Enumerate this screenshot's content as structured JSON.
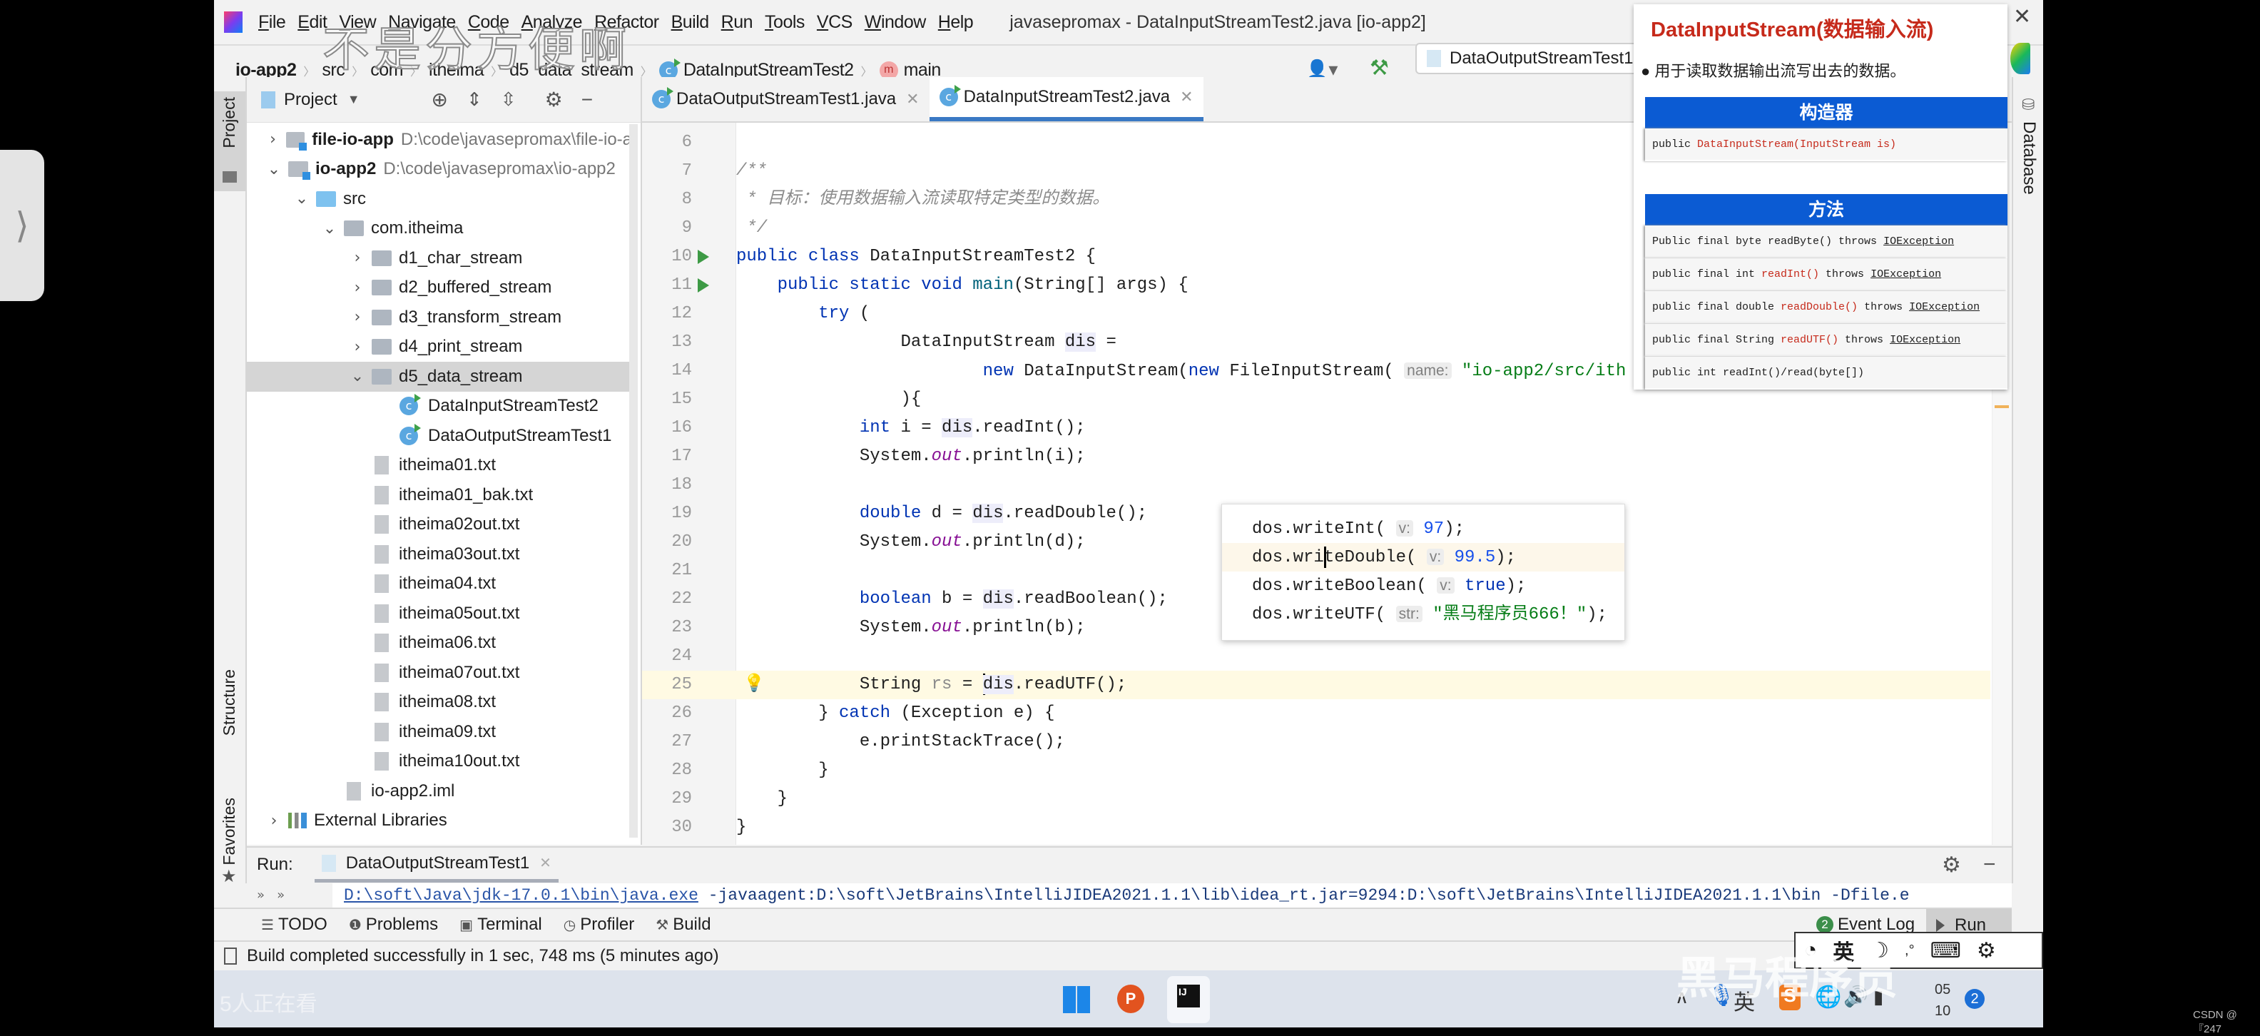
{
  "window": {
    "title": "javasepromax - DataInputStreamTest2.java [io-app2]",
    "watermark": "不是分方便啊"
  },
  "menu": [
    "File",
    "Edit",
    "View",
    "Navigate",
    "Code",
    "Analyze",
    "Refactor",
    "Build",
    "Run",
    "Tools",
    "VCS",
    "Window",
    "Help"
  ],
  "breadcrumb": [
    "io-app2",
    "src",
    "com",
    "itheima",
    "d5_data_stream",
    "DataInputStreamTest2",
    "main"
  ],
  "toolbar": {
    "run_config": "DataOutputStreamTest1"
  },
  "left_strip": {
    "project": "Project",
    "structure": "Structure",
    "favorites": "Favorites"
  },
  "right_strip": {
    "database": "Database"
  },
  "project_panel": {
    "title": "Project",
    "tree": [
      {
        "label": "file-io-app",
        "path": "D:\\code\\javasepromax\\file-io-a",
        "depth": 0,
        "expanded": false,
        "icon": "module",
        "bold": true
      },
      {
        "label": "io-app2",
        "path": "D:\\code\\javasepromax\\io-app2",
        "depth": 0,
        "expanded": true,
        "icon": "module",
        "bold": true
      },
      {
        "label": "src",
        "depth": 1,
        "expanded": true,
        "icon": "source-folder"
      },
      {
        "label": "com.itheima",
        "depth": 2,
        "expanded": true,
        "icon": "package"
      },
      {
        "label": "d1_char_stream",
        "depth": 3,
        "expanded": false,
        "icon": "package"
      },
      {
        "label": "d2_buffered_stream",
        "depth": 3,
        "expanded": false,
        "icon": "package"
      },
      {
        "label": "d3_transform_stream",
        "depth": 3,
        "expanded": false,
        "icon": "package"
      },
      {
        "label": "d4_print_stream",
        "depth": 3,
        "expanded": false,
        "icon": "package"
      },
      {
        "label": "d5_data_stream",
        "depth": 3,
        "expanded": true,
        "icon": "package",
        "selected": true
      },
      {
        "label": "DataInputStreamTest2",
        "depth": 4,
        "icon": "class"
      },
      {
        "label": "DataOutputStreamTest1",
        "depth": 4,
        "icon": "class"
      },
      {
        "label": "itheima01.txt",
        "depth": 3,
        "icon": "text-file"
      },
      {
        "label": "itheima01_bak.txt",
        "depth": 3,
        "icon": "text-file"
      },
      {
        "label": "itheima02out.txt",
        "depth": 3,
        "icon": "text-file"
      },
      {
        "label": "itheima03out.txt",
        "depth": 3,
        "icon": "text-file"
      },
      {
        "label": "itheima04.txt",
        "depth": 3,
        "icon": "text-file"
      },
      {
        "label": "itheima05out.txt",
        "depth": 3,
        "icon": "text-file"
      },
      {
        "label": "itheima06.txt",
        "depth": 3,
        "icon": "text-file"
      },
      {
        "label": "itheima07out.txt",
        "depth": 3,
        "icon": "text-file"
      },
      {
        "label": "itheima08.txt",
        "depth": 3,
        "icon": "text-file"
      },
      {
        "label": "itheima09.txt",
        "depth": 3,
        "icon": "text-file"
      },
      {
        "label": "itheima10out.txt",
        "depth": 3,
        "icon": "text-file"
      },
      {
        "label": "io-app2.iml",
        "depth": 2,
        "icon": "iml-file"
      },
      {
        "label": "External Libraries",
        "depth": 0,
        "expanded": false,
        "icon": "library"
      }
    ]
  },
  "editor": {
    "tabs": [
      {
        "label": "DataOutputStreamTest1.java",
        "active": false
      },
      {
        "label": "DataInputStreamTest2.java",
        "active": true
      }
    ],
    "current_line": 25,
    "lines": [
      {
        "n": 6,
        "t": []
      },
      {
        "n": 7,
        "t": [
          [
            "c",
            "/**"
          ]
        ]
      },
      {
        "n": 8,
        "t": [
          [
            "c",
            " * 目标：使用数据输入流读取特定类型的数据。"
          ]
        ]
      },
      {
        "n": 9,
        "t": [
          [
            "c",
            " */"
          ]
        ]
      },
      {
        "n": 10,
        "run": true,
        "t": [
          [
            "k",
            "public class "
          ],
          [
            "p",
            "DataInputStreamTest2 {"
          ]
        ]
      },
      {
        "n": 11,
        "run": true,
        "t": [
          [
            "p",
            "    "
          ],
          [
            "k",
            "public static void "
          ],
          [
            "m",
            "main"
          ],
          [
            "p",
            "(String[] args) {"
          ]
        ]
      },
      {
        "n": 12,
        "t": [
          [
            "p",
            "        "
          ],
          [
            "k",
            "try"
          ],
          [
            "p",
            " ("
          ]
        ]
      },
      {
        "n": 13,
        "t": [
          [
            "p",
            "                DataInputStream "
          ],
          [
            "v",
            "dis"
          ],
          [
            "p",
            " ="
          ]
        ]
      },
      {
        "n": 14,
        "t": [
          [
            "p",
            "                        "
          ],
          [
            "k",
            "new "
          ],
          [
            "p",
            "DataInputStream("
          ],
          [
            "k",
            "new "
          ],
          [
            "p",
            "FileInputStream( "
          ],
          [
            "h",
            "name:"
          ],
          [
            "s",
            " \"io-app2/src/ith"
          ]
        ]
      },
      {
        "n": 15,
        "t": [
          [
            "p",
            "                ){"
          ]
        ]
      },
      {
        "n": 16,
        "t": [
          [
            "p",
            "            "
          ],
          [
            "k",
            "int "
          ],
          [
            "p",
            "i = "
          ],
          [
            "v",
            "dis"
          ],
          [
            "p",
            ".readInt();"
          ]
        ]
      },
      {
        "n": 17,
        "t": [
          [
            "p",
            "            System."
          ],
          [
            "f",
            "out"
          ],
          [
            "p",
            ".println(i);"
          ]
        ]
      },
      {
        "n": 18,
        "t": []
      },
      {
        "n": 19,
        "t": [
          [
            "p",
            "            "
          ],
          [
            "k",
            "double "
          ],
          [
            "p",
            "d = "
          ],
          [
            "v",
            "dis"
          ],
          [
            "p",
            ".readDouble();"
          ]
        ]
      },
      {
        "n": 20,
        "t": [
          [
            "p",
            "            System."
          ],
          [
            "f",
            "out"
          ],
          [
            "p",
            ".println(d);"
          ]
        ]
      },
      {
        "n": 21,
        "t": []
      },
      {
        "n": 22,
        "t": [
          [
            "p",
            "            "
          ],
          [
            "k",
            "boolean "
          ],
          [
            "p",
            "b = "
          ],
          [
            "v",
            "dis"
          ],
          [
            "p",
            ".readBoolean();"
          ]
        ]
      },
      {
        "n": 23,
        "t": [
          [
            "p",
            "            System."
          ],
          [
            "f",
            "out"
          ],
          [
            "p",
            ".println(b);"
          ]
        ]
      },
      {
        "n": 24,
        "t": []
      },
      {
        "n": 25,
        "bulb": true,
        "t": [
          [
            "p",
            "            String "
          ],
          [
            "g",
            "rs"
          ],
          [
            "p",
            " = "
          ],
          [
            "caret",
            ""
          ],
          [
            "v",
            "dis"
          ],
          [
            "p",
            ".readUTF();"
          ]
        ]
      },
      {
        "n": 26,
        "t": [
          [
            "p",
            "        } "
          ],
          [
            "k",
            "catch "
          ],
          [
            "p",
            "(Exception e) {"
          ]
        ]
      },
      {
        "n": 27,
        "t": [
          [
            "p",
            "            e.printStackTrace();"
          ]
        ]
      },
      {
        "n": 28,
        "t": [
          [
            "p",
            "        }"
          ]
        ]
      },
      {
        "n": 29,
        "t": [
          [
            "p",
            "    }"
          ]
        ]
      },
      {
        "n": 30,
        "t": [
          [
            "p",
            "}"
          ]
        ]
      }
    ]
  },
  "snippet_popup": {
    "lines": [
      {
        "t": [
          [
            "p",
            "dos.writeInt( "
          ],
          [
            "h",
            "v:"
          ],
          [
            "n",
            " 97"
          ],
          [
            "p",
            ");"
          ]
        ]
      },
      {
        "hl": true,
        "t": [
          [
            "p",
            "dos.wri"
          ],
          [
            "caret",
            ""
          ],
          [
            "p",
            "teDouble( "
          ],
          [
            "h",
            "v:"
          ],
          [
            "n",
            " 99.5"
          ],
          [
            "p",
            ");"
          ]
        ]
      },
      {
        "t": [
          [
            "p",
            "dos.writeBoolean( "
          ],
          [
            "h",
            "v:"
          ],
          [
            "k",
            " true"
          ],
          [
            "p",
            ");"
          ]
        ]
      },
      {
        "t": [
          [
            "p",
            "dos.writeUTF( "
          ],
          [
            "h",
            "str:"
          ],
          [
            "s",
            " \"黑马程序员666！\""
          ],
          [
            "p",
            ");"
          ]
        ]
      }
    ]
  },
  "doc_popup": {
    "title": "DataInputStream(数据输入流)",
    "bullet": "用于读取数据输出流写出去的数据。",
    "constructor_header": "构造器",
    "constructor": {
      "pre": "public ",
      "sig": "DataInputStream(InputStream is)"
    },
    "methods_header": "方法",
    "methods": [
      {
        "pre": "Public final byte readByte() throws ",
        "hl": "",
        "post": "",
        "exc": "IOException"
      },
      {
        "pre": "public final int ",
        "hl": "readInt()",
        "post": " throws ",
        "exc": "IOException"
      },
      {
        "pre": "public final double ",
        "hl": "readDouble()",
        "post": " throws ",
        "exc": "IOException"
      },
      {
        "pre": "public final String ",
        "hl": "readUTF()",
        "post": " throws ",
        "exc": "IOException"
      },
      {
        "pre": "public int readInt()/read(byte[])",
        "hl": "",
        "post": "",
        "exc": ""
      }
    ],
    "accent": "#0b5bd3",
    "title_color": "#c62a1b"
  },
  "run_panel": {
    "label": "Run:",
    "tab": "DataOutputStreamTest1",
    "console_link": "D:\\soft\\Java\\jdk-17.0.1\\bin\\java.exe",
    "console_rest": " -javaagent:D:\\soft\\JetBrains\\IntelliJIDEA2021.1.1\\lib\\idea_rt.jar=9294:D:\\soft\\JetBrains\\IntelliJIDEA2021.1.1\\bin -Dfile.e"
  },
  "tool_tabs": [
    "TODO",
    "Problems",
    "Terminal",
    "Profiler",
    "Build"
  ],
  "event_log": {
    "count": "2",
    "label": "Event Log"
  },
  "run_tab": "Run",
  "status": "Build completed successfully in 1 sec, 748 ms (5 minutes ago)",
  "ime": {
    "lang": "英"
  },
  "overlay": {
    "viewers": "5人正在看",
    "brand": "黑马程序员",
    "credit": "CSDN @『247"
  },
  "taskbar": {
    "ime": "英",
    "time_top": "05",
    "time_bottom": "10",
    "notifications": "2"
  }
}
